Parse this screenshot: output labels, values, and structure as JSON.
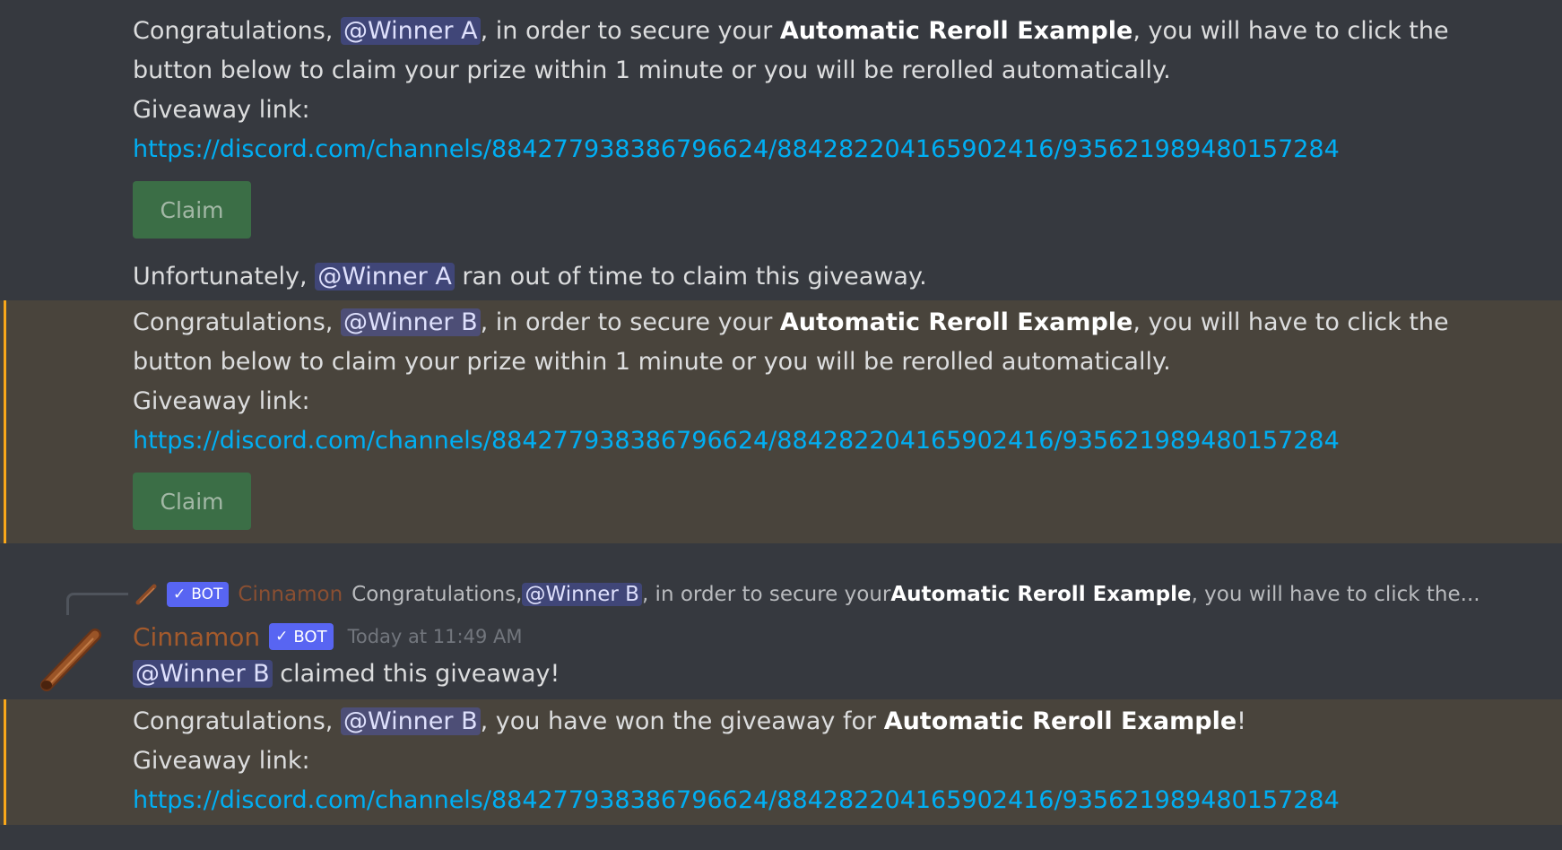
{
  "messages": {
    "m1": {
      "prefix": "Congratulations, ",
      "mention": "@Winner A",
      "mid": ", in order to secure your ",
      "prize": "Automatic Reroll Example",
      "suffix": ", you will have to click the",
      "line2": "button below to claim your prize within 1 minute or you will be rerolled automatically.",
      "link_label": "Giveaway link:",
      "link": "https://discord.com/channels/884277938386796624/884282204165902416/935621989480157284",
      "button": "Claim"
    },
    "m2": {
      "prefix": "Unfortunately, ",
      "mention": "@Winner A",
      "suffix": " ran out of time to claim this giveaway."
    },
    "m3": {
      "prefix": "Congratulations, ",
      "mention": "@Winner B",
      "mid": ", in order to secure your ",
      "prize": "Automatic Reroll Example",
      "suffix": ", you will have to click the",
      "line2": "button below to claim your prize within 1 minute or you will be rerolled automatically.",
      "link_label": "Giveaway link:",
      "link": "https://discord.com/channels/884277938386796624/884282204165902416/935621989480157284",
      "button": "Claim"
    },
    "reply": {
      "bot_tag": "BOT",
      "author": "Cinnamon",
      "prefix": "Congratulations, ",
      "mention": "@Winner B",
      "mid": ", in order to secure your ",
      "prize": "Automatic Reroll Example",
      "suffix": ", you will have to click the..."
    },
    "m4": {
      "author": "Cinnamon",
      "bot_tag": "BOT",
      "timestamp": "Today at 11:49 AM",
      "mention": "@Winner B",
      "suffix": " claimed this giveaway!"
    },
    "m5": {
      "prefix": "Congratulations, ",
      "mention": "@Winner B",
      "mid": ", you have won the giveaway for ",
      "prize": "Automatic Reroll Example",
      "suffix": "!",
      "link_label": "Giveaway link:",
      "link": "https://discord.com/channels/884277938386796624/884282204165902416/935621989480157284"
    }
  },
  "icons": {
    "avatar": "cinnamon-stick-icon",
    "check": "checkmark-icon",
    "reply": "reply-connector-icon"
  },
  "colors": {
    "background": "#36393f",
    "highlight": "#49443c",
    "highlight_bar": "#faa81a",
    "link": "#00aff4",
    "mention_bg": "#414675",
    "bot_tag": "#5865f2",
    "author": "#a45a2c",
    "claim_button": "#3b6e46"
  }
}
